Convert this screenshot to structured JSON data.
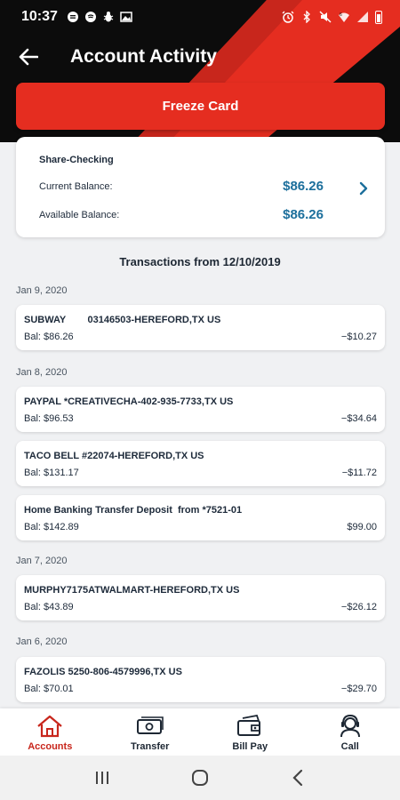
{
  "status_bar": {
    "time": "10:37",
    "left_icons": [
      "message-icon",
      "music-icon",
      "bug-icon",
      "image-icon"
    ],
    "right_icons": [
      "alarm-icon",
      "bluetooth-icon",
      "mute-icon",
      "wifi-icon",
      "signal-icon",
      "battery-icon"
    ]
  },
  "header": {
    "title": "Account Activity",
    "freeze_label": "Freeze Card",
    "accent_color": "#e52d20"
  },
  "account": {
    "name": "Share-Checking",
    "current_label": "Current Balance:",
    "current_value": "$86.26",
    "available_label": "Available Balance:",
    "available_value": "$86.26"
  },
  "transactions_header": "Transactions from 12/10/2019",
  "groups": [
    {
      "date": "Jan 9, 2020",
      "items": [
        {
          "desc": "SUBWAY        03146503-HEREFORD,TX US",
          "bal": "Bal: $86.26",
          "amount": "−$10.27"
        }
      ]
    },
    {
      "date": "Jan 8, 2020",
      "items": [
        {
          "desc": "PAYPAL *CREATIVECHA-402-935-7733,TX US",
          "bal": "Bal: $96.53",
          "amount": "−$34.64"
        },
        {
          "desc": "TACO BELL #22074-HEREFORD,TX US",
          "bal": "Bal: $131.17",
          "amount": "−$11.72"
        },
        {
          "desc": "Home Banking Transfer Deposit  from *7521-01",
          "bal": "Bal: $142.89",
          "amount": "$99.00"
        }
      ]
    },
    {
      "date": "Jan 7, 2020",
      "items": [
        {
          "desc": "MURPHY7175ATWALMART-HEREFORD,TX US",
          "bal": "Bal: $43.89",
          "amount": "−$26.12"
        }
      ]
    },
    {
      "date": "Jan 6, 2020",
      "items": [
        {
          "desc": "FAZOLIS 5250-806-4579996,TX US",
          "bal": "Bal: $70.01",
          "amount": "−$29.70"
        }
      ]
    }
  ],
  "bottom_nav": [
    {
      "label": "Accounts",
      "icon": "home-icon",
      "active": true
    },
    {
      "label": "Transfer",
      "icon": "money-transfer-icon",
      "active": false
    },
    {
      "label": "Bill Pay",
      "icon": "bill-pay-icon",
      "active": false
    },
    {
      "label": "Call",
      "icon": "headset-icon",
      "active": false
    }
  ],
  "system_nav": [
    "recents-icon",
    "home-circle-icon",
    "back-chevron-icon"
  ]
}
